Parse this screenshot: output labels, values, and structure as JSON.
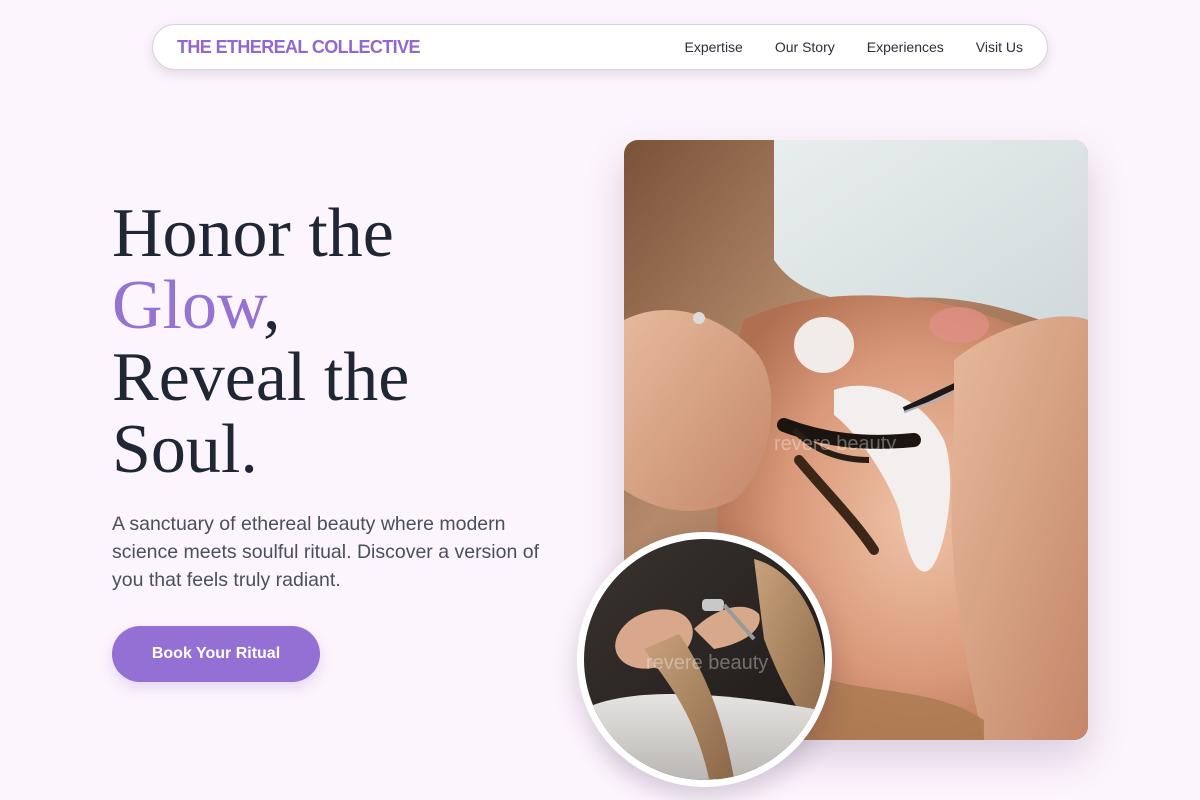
{
  "nav": {
    "brand": "THE ETHEREAL COLLECTIVE",
    "links": [
      "Expertise",
      "Our Story",
      "Experiences",
      "Visit Us"
    ]
  },
  "hero": {
    "headline_part1": "Honor the",
    "headline_accent": "Glow",
    "headline_comma": ",",
    "headline_part2": "Reveal the",
    "headline_part3": "Soul.",
    "lead": "A sanctuary of ethereal beauty where modern science meets soulful ritual. Discover a version of you that feels truly radiant.",
    "cta_label": "Book Your Ritual"
  },
  "images": {
    "main_watermark": "revere beauty",
    "inset_watermark": "revere beauty"
  },
  "colors": {
    "background": "#fdf5fd",
    "accent": "#9570d4",
    "heading": "#1f2735",
    "body_text": "#4a4f5c"
  }
}
